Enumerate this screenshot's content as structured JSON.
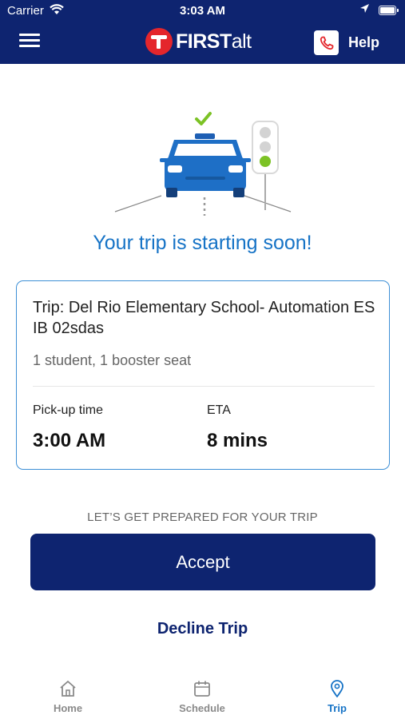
{
  "status_bar": {
    "carrier": "Carrier",
    "time": "3:03 AM"
  },
  "header": {
    "logo_bold": "FIRST",
    "logo_thin": "alt",
    "help_label": "Help"
  },
  "illustration": {
    "icons": [
      "car-icon",
      "checkmark-icon",
      "traffic-light-icon"
    ],
    "signal": "green"
  },
  "headline": "Your trip is starting soon!",
  "trip_card": {
    "title": "Trip: Del Rio Elementary School- Automation ES IB 02sdas",
    "details": "1 student, 1 booster seat",
    "pickup_label": "Pick-up time",
    "pickup_value": "3:00 AM",
    "eta_label": "ETA",
    "eta_value": "8 mins"
  },
  "prepare_text": "LET’S GET PREPARED FOR YOUR TRIP",
  "accept_label": "Accept",
  "decline_label": "Decline Trip",
  "tabs": [
    {
      "label": "Home",
      "icon": "home-icon",
      "active": false
    },
    {
      "label": "Schedule",
      "icon": "calendar-icon",
      "active": false
    },
    {
      "label": "Trip",
      "icon": "map-pin-icon",
      "active": true
    }
  ],
  "colors": {
    "primary": "#0e2470",
    "accent_blue": "#1673c6",
    "brand_red": "#e4262c",
    "success_green": "#7cc225",
    "inactive": "#8a8a8a"
  }
}
